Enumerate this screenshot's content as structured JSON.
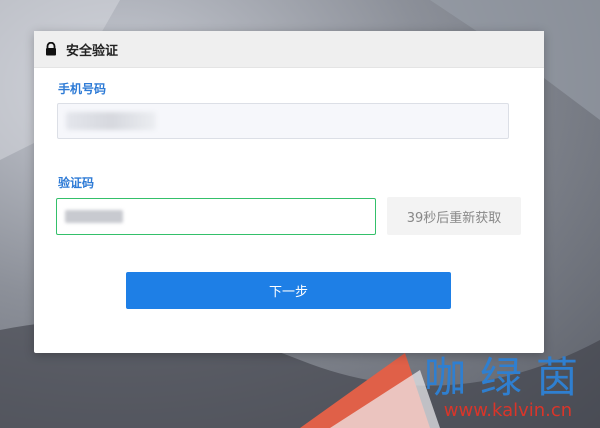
{
  "dialog": {
    "title": "安全验证",
    "phone_label": "手机号码",
    "code_label": "验证码",
    "resend_label": "39秒后重新获取",
    "next_label": "下一步"
  },
  "watermark": {
    "text": "咖绿茵",
    "url": "www.kalvin.cn"
  },
  "colors": {
    "accent_blue": "#1e7fe6",
    "label_blue": "#2e7bd6",
    "focus_green": "#34c06a"
  }
}
